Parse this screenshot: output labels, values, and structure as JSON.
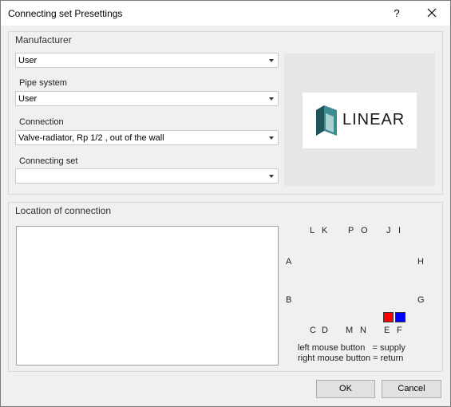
{
  "window": {
    "title": "Connecting set Presettings",
    "help_label": "?"
  },
  "manufacturer_group": {
    "label": "Manufacturer",
    "manufacturer_value": "User",
    "pipe_system_label": "Pipe system",
    "pipe_system_value": "User",
    "connection_label": "Connection",
    "connection_value": "Valve-radiator, Rp 1/2 , out of the wall",
    "connecting_set_label": "Connecting set",
    "connecting_set_value": "",
    "logo_text": "LINEAR"
  },
  "location_group": {
    "label": "Location of connection",
    "letters": {
      "L": "L",
      "K": "K",
      "P": "P",
      "O": "O",
      "J": "J",
      "I": "I",
      "A": "A",
      "H": "H",
      "B": "B",
      "G": "G",
      "C": "C",
      "D": "D",
      "M": "M",
      "N": "N",
      "E": "E",
      "F": "F"
    },
    "supply_color": "#ff0000",
    "return_color": "#0000ff",
    "legend_line1": "left mouse button   = supply",
    "legend_line2": "right mouse button = return"
  },
  "buttons": {
    "ok_label": "OK",
    "cancel_label": "Cancel"
  },
  "colors": {
    "background": "#f0f0f0",
    "logo_mark": "#2a6b6e"
  },
  "icons": {
    "close": "close-icon",
    "dropdown": "chevron-down-icon",
    "logo": "linear-logo-icon"
  }
}
